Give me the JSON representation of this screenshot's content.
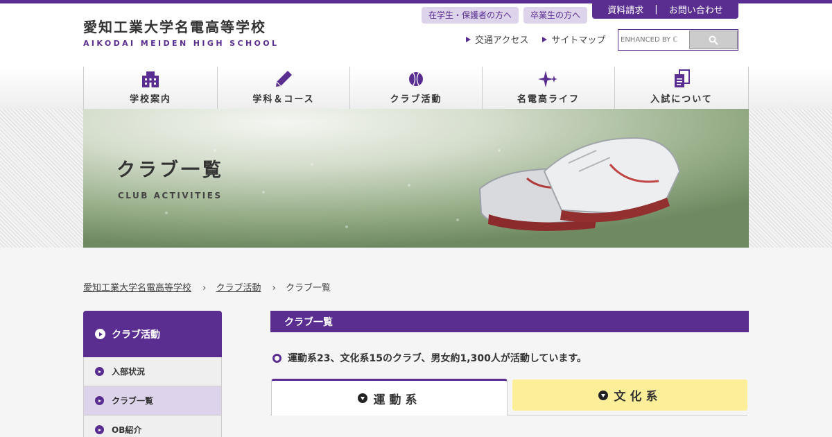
{
  "header": {
    "logo_ja": "愛知工業大学名電高等学校",
    "logo_en": "AIKODAI MEIDEN HIGH SCHOOL",
    "pill_students": "在学生・保護者の方へ",
    "pill_alumni": "卒業生の方へ",
    "request": "資料請求",
    "request_sep": "|",
    "contact": "お問い合わせ",
    "access": "交通アクセス",
    "sitemap": "サイトマップ",
    "search_placeholder": "ENHANCED BY ℂ"
  },
  "nav": {
    "items": [
      {
        "label": "学校案内",
        "icon": "building-icon"
      },
      {
        "label": "学科＆コース",
        "icon": "pencil-icon"
      },
      {
        "label": "クラブ活動",
        "icon": "ball-icon"
      },
      {
        "label": "名電高ライフ",
        "icon": "sparkle-icon"
      },
      {
        "label": "入試について",
        "icon": "documents-icon"
      }
    ]
  },
  "hero": {
    "title": "クラブ一覧",
    "subtitle": "CLUB ACTIVITIES"
  },
  "breadcrumb": {
    "home": "愛知工業大学名電高等学校",
    "parent": "クラブ活動",
    "current": "クラブ一覧",
    "sep": "›"
  },
  "sidebar": {
    "heading": "クラブ活動",
    "items": [
      {
        "label": "入部状況"
      },
      {
        "label": "クラブ一覧"
      },
      {
        "label": "OB紹介"
      }
    ]
  },
  "main": {
    "heading": "クラブ一覧",
    "intro": "運動系23、文化系15のクラブ、男女約1,300人が活動しています。",
    "tabs": [
      {
        "label": "運動系"
      },
      {
        "label": "文化系"
      }
    ]
  },
  "colors": {
    "accent": "#5a2d91",
    "pill_bg": "#ddd3ea",
    "tab_culture_bg": "#fdee9a"
  }
}
